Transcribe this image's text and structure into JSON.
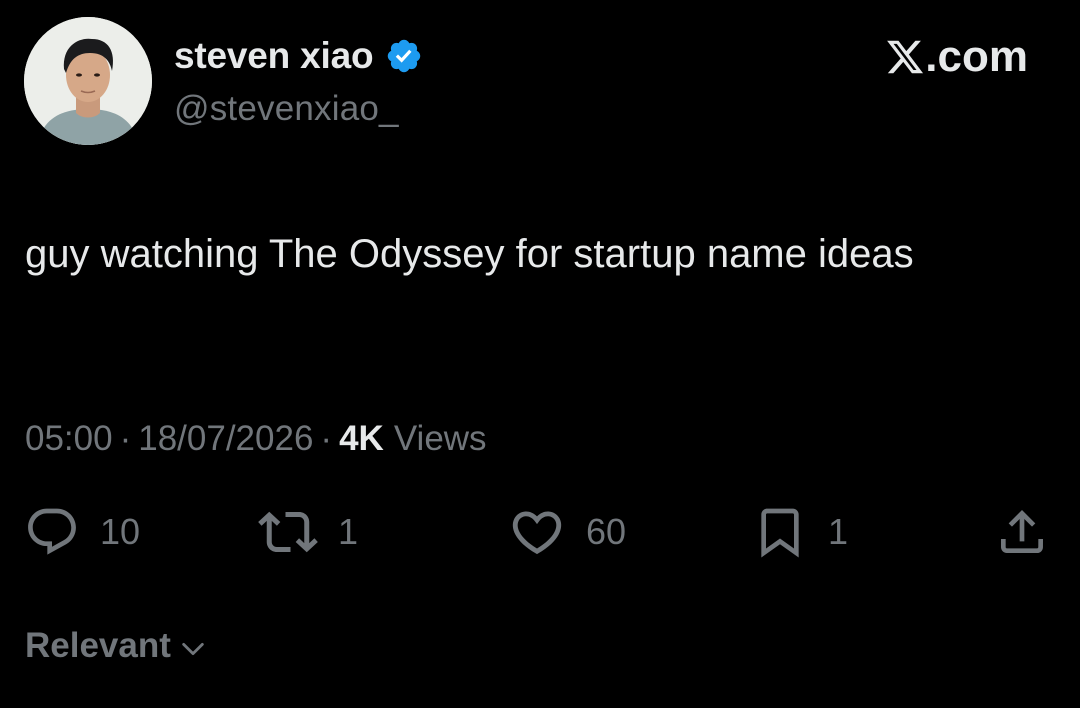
{
  "author": {
    "display_name": "steven xiao",
    "handle": "@stevenxiao_",
    "verified": true,
    "avatar_icon": "profile-photo"
  },
  "brand": {
    "label": ".com",
    "icon": "x-logo-icon"
  },
  "tweet": {
    "text": "guy watching The Odyssey for startup name ideas"
  },
  "meta": {
    "time": "05:00",
    "separator": "·",
    "date": "18/07/2026",
    "views_count": "4K",
    "views_label": "Views"
  },
  "actions": {
    "reply": {
      "icon": "reply-icon",
      "count": "10"
    },
    "repost": {
      "icon": "repost-icon",
      "count": "1"
    },
    "like": {
      "icon": "heart-icon",
      "count": "60"
    },
    "bookmark": {
      "icon": "bookmark-icon",
      "count": "1"
    },
    "share": {
      "icon": "share-icon"
    }
  },
  "sort": {
    "label": "Relevant",
    "icon": "chevron-down-icon"
  },
  "colors": {
    "background": "#000000",
    "primary_text": "#e7e9ea",
    "secondary_text": "#71767b",
    "verified_blue": "#1d9bf0"
  }
}
